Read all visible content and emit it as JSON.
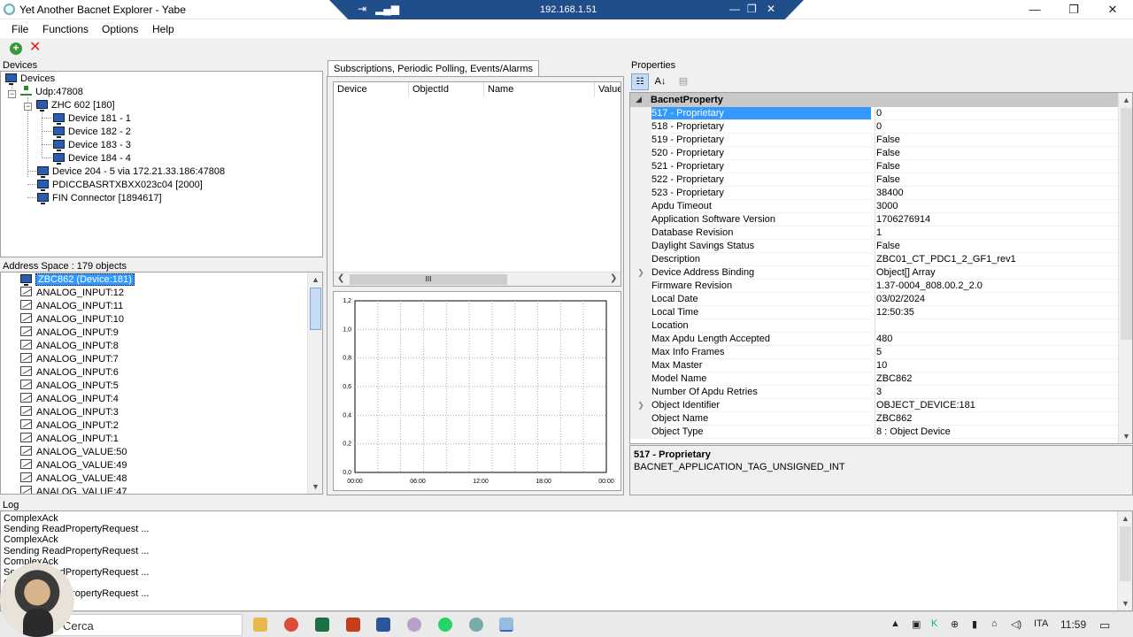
{
  "window": {
    "title": "Yet Another Bacnet Explorer - Yabe",
    "remote_ip": "192.168.1.51",
    "minimize": "—",
    "maximize": "❐",
    "close": "✕"
  },
  "menu": [
    "File",
    "Functions",
    "Options",
    "Help"
  ],
  "devices": {
    "label": "Devices",
    "root": "Devices",
    "udp": "Udp:47808",
    "zhc": "ZHC 602 [180]",
    "children": [
      "Device 181 - 1",
      "Device 182 - 2",
      "Device 183 - 3",
      "Device 184 - 4"
    ],
    "device204": "Device 204 - 5  via 172.21.33.186:47808",
    "pdic": "PDICCBASRTXBXX023c04 [2000]",
    "fin": "FIN Connector [1894617]"
  },
  "address_space": {
    "label": "Address Space : 179 objects",
    "selected": "ZBC862 (Device:181)",
    "items": [
      "ANALOG_INPUT:12",
      "ANALOG_INPUT:11",
      "ANALOG_INPUT:10",
      "ANALOG_INPUT:9",
      "ANALOG_INPUT:8",
      "ANALOG_INPUT:7",
      "ANALOG_INPUT:6",
      "ANALOG_INPUT:5",
      "ANALOG_INPUT:4",
      "ANALOG_INPUT:3",
      "ANALOG_INPUT:2",
      "ANALOG_INPUT:1",
      "ANALOG_VALUE:50",
      "ANALOG_VALUE:49",
      "ANALOG_VALUE:48",
      "ANALOG_VALUE:47"
    ]
  },
  "subscriptions": {
    "tab": "Subscriptions, Periodic Polling, Events/Alarms",
    "columns": [
      "Device",
      "ObjectId",
      "Name",
      "Value"
    ],
    "scroll_thumb": "III"
  },
  "chart": {
    "y_ticks": [
      "1,2",
      "1,0",
      "0,8",
      "0,6",
      "0,4",
      "0,2",
      "0,0"
    ],
    "x_ticks": [
      "00:00",
      "06:00",
      "12:00",
      "18:00",
      "00:00"
    ]
  },
  "properties": {
    "label": "Properties",
    "category": "BacnetProperty",
    "rows": [
      {
        "name": "517 - Proprietary",
        "value": "0"
      },
      {
        "name": "518 - Proprietary",
        "value": "0"
      },
      {
        "name": "519 - Proprietary",
        "value": "False"
      },
      {
        "name": "520 - Proprietary",
        "value": "False"
      },
      {
        "name": "521 - Proprietary",
        "value": "False"
      },
      {
        "name": "522 - Proprietary",
        "value": "False"
      },
      {
        "name": "523 - Proprietary",
        "value": "38400"
      },
      {
        "name": "Apdu Timeout",
        "value": "3000"
      },
      {
        "name": "Application Software Version",
        "value": "1706276914"
      },
      {
        "name": "Database Revision",
        "value": "1"
      },
      {
        "name": "Daylight Savings Status",
        "value": "False"
      },
      {
        "name": "Description",
        "value": "ZBC01_CT_PDC1_2_GF1_rev1"
      },
      {
        "name": "Device Address Binding",
        "value": "Object[] Array"
      },
      {
        "name": "Firmware Revision",
        "value": "1.37-0004_808.00.2_2.0"
      },
      {
        "name": "Local Date",
        "value": "03/02/2024"
      },
      {
        "name": "Local Time",
        "value": "12:50:35"
      },
      {
        "name": "Location",
        "value": ""
      },
      {
        "name": "Max Apdu Length Accepted",
        "value": "480"
      },
      {
        "name": "Max Info Frames",
        "value": "5"
      },
      {
        "name": "Max Master",
        "value": "10"
      },
      {
        "name": "Model Name",
        "value": "ZBC862"
      },
      {
        "name": "Number Of Apdu Retries",
        "value": "3"
      },
      {
        "name": "Object Identifier",
        "value": "OBJECT_DEVICE:181"
      },
      {
        "name": "Object Name",
        "value": "ZBC862"
      },
      {
        "name": "Object Type",
        "value": "8 : Object Device"
      }
    ],
    "desc_title": "517 - Proprietary",
    "desc_text": "BACNET_APPLICATION_TAG_UNSIGNED_INT"
  },
  "log": {
    "label": "Log",
    "lines": [
      "ComplexAck",
      "Sending ReadPropertyRequest ...",
      "ComplexAck",
      "Sending ReadPropertyRequest ...",
      "ComplexAck",
      "Sending ReadPropertyRequest ...",
      "ComplexAck",
      "Sending ReadPropertyRequest ..."
    ]
  },
  "taskbar": {
    "search_placeholder": "Cerca",
    "lang": "ITA",
    "time": "11:59"
  },
  "colors": {
    "selection": "#3399ff",
    "category_bg": "#c8c8c8",
    "rdp_bar": "#1f4e8a"
  }
}
